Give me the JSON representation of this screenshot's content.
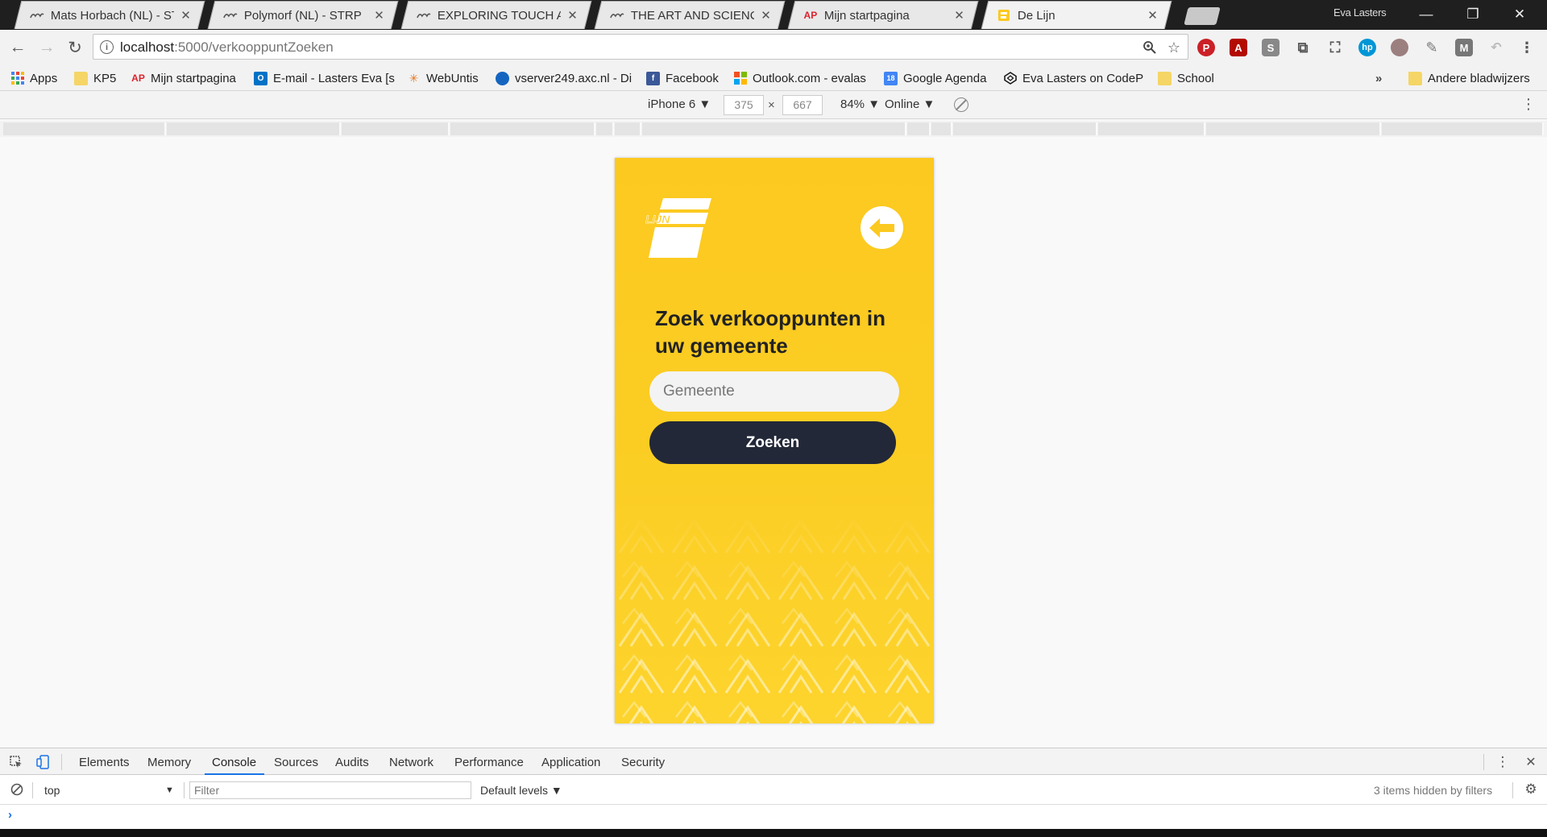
{
  "tabs": [
    {
      "title": "Mats Horbach (NL) - STR",
      "favicon": "strp-icon",
      "active": false
    },
    {
      "title": "Polymorf (NL) - STRP",
      "favicon": "strp-icon",
      "active": false
    },
    {
      "title": "EXPLORING TOUCH AS A",
      "favicon": "strp-icon",
      "active": false
    },
    {
      "title": "THE ART AND SCIENCE O",
      "favicon": "strp-icon",
      "active": false
    },
    {
      "title": "Mijn startpagina",
      "favicon": "ap-icon",
      "active": false
    },
    {
      "title": "De Lijn",
      "favicon": "de-lijn-icon",
      "active": true
    }
  ],
  "profile_name": "Eva Lasters",
  "address": {
    "host": "localhost",
    "path": ":5000/verkooppuntZoeken"
  },
  "bookmarks": [
    {
      "label": "Apps",
      "icon": "apps-grid-icon"
    },
    {
      "label": "KP5",
      "icon": "folder-icon"
    },
    {
      "label": "Mijn startpagina",
      "icon": "ap-icon"
    },
    {
      "label": "E-mail - Lasters Eva [s",
      "icon": "outlook-icon"
    },
    {
      "label": "WebUntis",
      "icon": "webuntis-icon"
    },
    {
      "label": "vserver249.axc.nl - Di",
      "icon": "globe-icon"
    },
    {
      "label": "Facebook",
      "icon": "facebook-icon"
    },
    {
      "label": "Outlook.com - evalas",
      "icon": "microsoft-icon"
    },
    {
      "label": "Google Agenda",
      "icon": "calendar-icon"
    },
    {
      "label": "Eva Lasters on CodeP",
      "icon": "codepen-icon"
    },
    {
      "label": "School",
      "icon": "folder-icon"
    }
  ],
  "bookmarks_overflow": "»",
  "other_bookmarks": "Andere bladwijzers",
  "device_toolbar": {
    "device": "iPhone 6 ▼",
    "width": "375",
    "times": "×",
    "height": "667",
    "zoom": "84% ▼",
    "network": "Online ▼"
  },
  "app": {
    "logo_text": "LIJN",
    "heading": "Zoek verkooppunten in uw gemeente",
    "search_placeholder": "Gemeente",
    "search_button": "Zoeken",
    "colors": {
      "background": "#fcc920",
      "button": "#222838",
      "input": "#f3f3f3"
    }
  },
  "devtools": {
    "tabs": [
      "Elements",
      "Memory",
      "Console",
      "Sources",
      "Audits",
      "Network",
      "Performance",
      "Application",
      "Security"
    ],
    "active_tab": "Console",
    "context": "top",
    "context_arrow": "▼",
    "filter_placeholder": "Filter",
    "levels": "Default levels ▼",
    "hidden_info": "3 items hidden by filters",
    "prompt": "›"
  }
}
